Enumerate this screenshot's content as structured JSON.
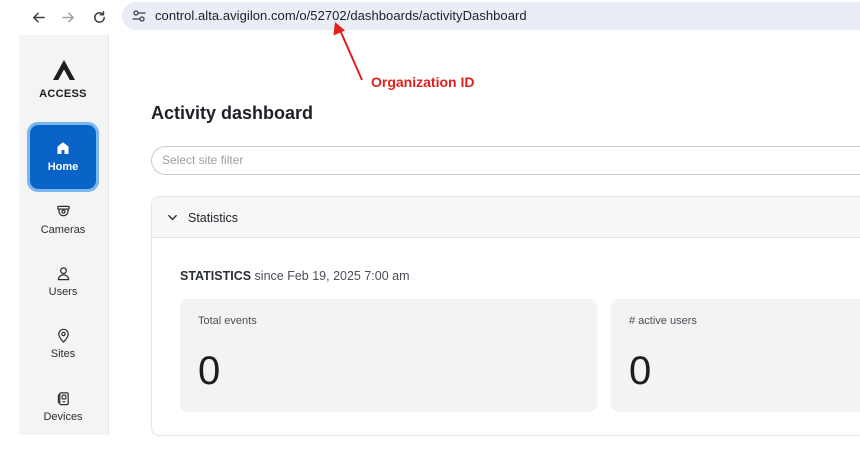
{
  "browser": {
    "url": "control.alta.avigilon.com/o/52702/dashboards/activityDashboard"
  },
  "sidebar": {
    "brand": "ACCESS",
    "items": [
      {
        "label": "Home",
        "icon": "home-icon",
        "active": true
      },
      {
        "label": "Cameras",
        "icon": "camera-icon"
      },
      {
        "label": "Users",
        "icon": "user-icon"
      },
      {
        "label": "Sites",
        "icon": "location-pin-icon"
      },
      {
        "label": "Devices",
        "icon": "device-icon"
      }
    ]
  },
  "main": {
    "title": "Activity dashboard",
    "site_filter_placeholder": "Select site filter",
    "statistics": {
      "header": "Statistics",
      "caption_strong": "STATISTICS",
      "caption_rest": " since Feb 19, 2025 7:00 am",
      "cards": [
        {
          "label": "Total events",
          "value": "0"
        },
        {
          "label": "# active users",
          "value": "0"
        }
      ]
    }
  },
  "annotation": {
    "label": "Organization ID",
    "color": "#e0201b"
  },
  "colors": {
    "accent": "#0a64c8",
    "accent_ring": "#7ab6ef",
    "sidebar_bg": "#f4f4f5",
    "url_bar_bg": "#e9eef6"
  }
}
